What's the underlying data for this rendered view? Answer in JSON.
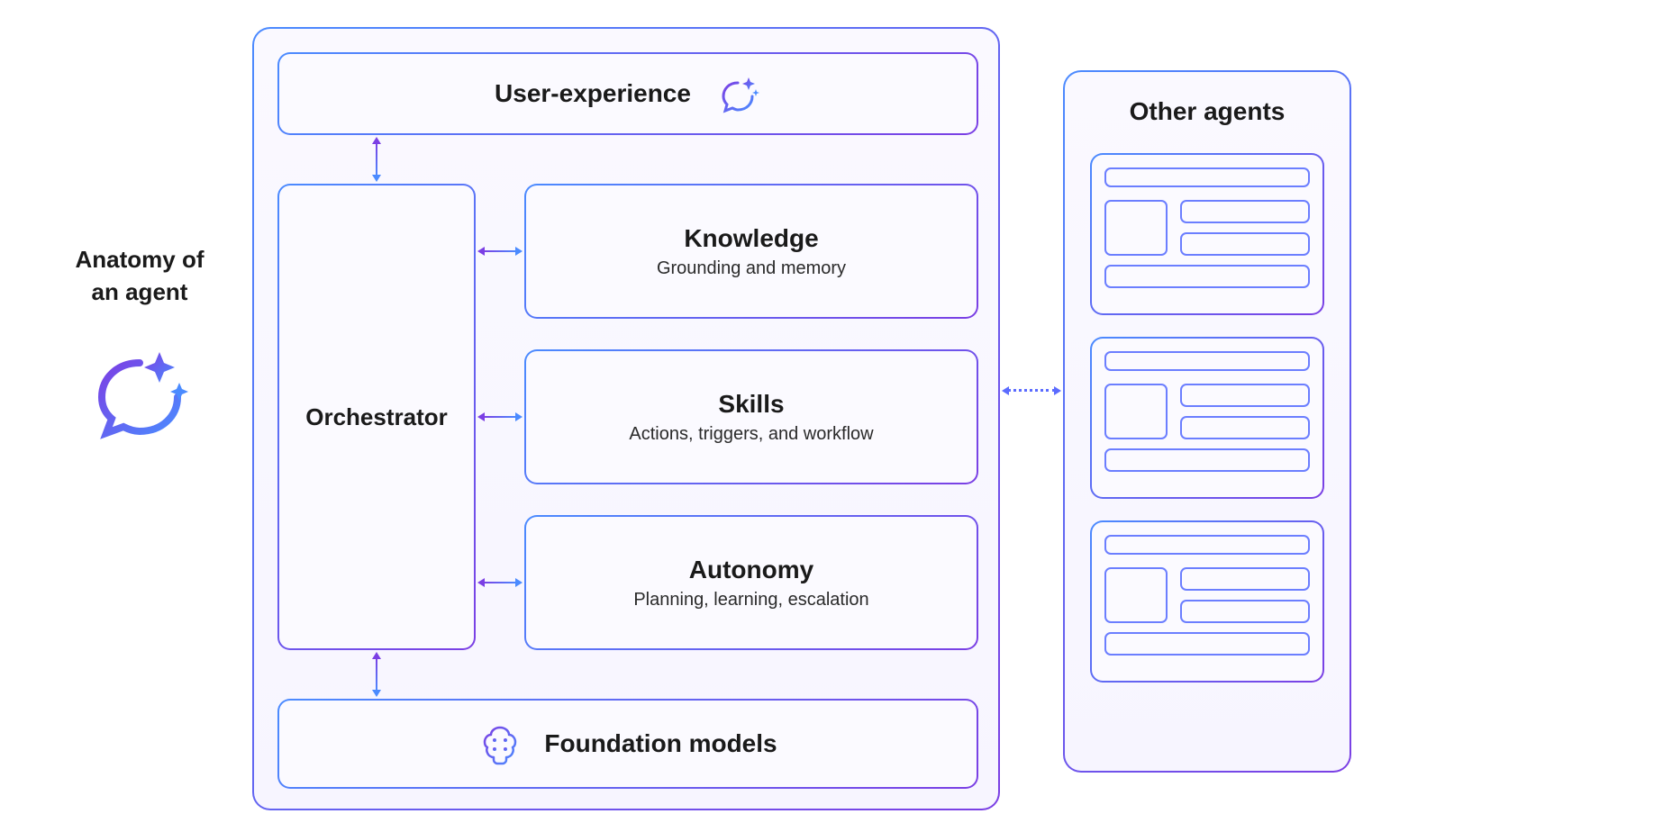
{
  "title": {
    "line1": "Anatomy of",
    "line2": "an agent"
  },
  "agent": {
    "user_experience": "User-experience",
    "orchestrator": "Orchestrator",
    "knowledge": {
      "title": "Knowledge",
      "subtitle": "Grounding and memory"
    },
    "skills": {
      "title": "Skills",
      "subtitle": "Actions, triggers, and workflow"
    },
    "autonomy": {
      "title": "Autonomy",
      "subtitle": "Planning, learning, escalation"
    },
    "foundation_models": "Foundation models"
  },
  "other_agents": {
    "title": "Other agents"
  },
  "colors": {
    "gradient_start": "#4B8BFF",
    "gradient_end": "#7B3FE4",
    "text": "#1a1a1a",
    "bg": "#faf9ff"
  }
}
